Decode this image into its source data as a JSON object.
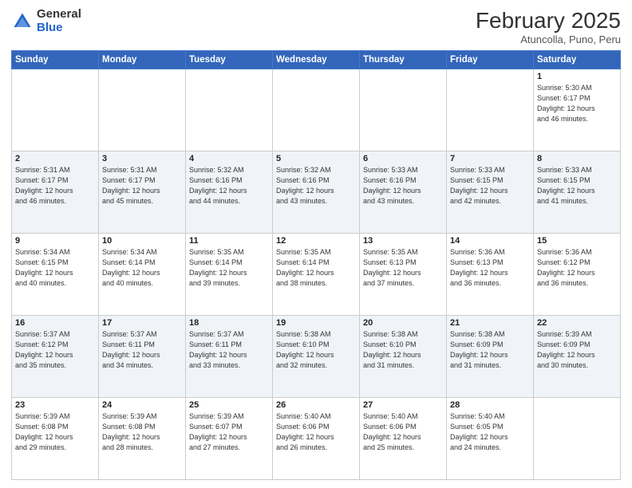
{
  "header": {
    "logo_general": "General",
    "logo_blue": "Blue",
    "month_year": "February 2025",
    "location": "Atuncolla, Puno, Peru"
  },
  "weekdays": [
    "Sunday",
    "Monday",
    "Tuesday",
    "Wednesday",
    "Thursday",
    "Friday",
    "Saturday"
  ],
  "weeks": [
    [
      {
        "day": "",
        "info": ""
      },
      {
        "day": "",
        "info": ""
      },
      {
        "day": "",
        "info": ""
      },
      {
        "day": "",
        "info": ""
      },
      {
        "day": "",
        "info": ""
      },
      {
        "day": "",
        "info": ""
      },
      {
        "day": "1",
        "info": "Sunrise: 5:30 AM\nSunset: 6:17 PM\nDaylight: 12 hours\nand 46 minutes."
      }
    ],
    [
      {
        "day": "2",
        "info": "Sunrise: 5:31 AM\nSunset: 6:17 PM\nDaylight: 12 hours\nand 46 minutes."
      },
      {
        "day": "3",
        "info": "Sunrise: 5:31 AM\nSunset: 6:17 PM\nDaylight: 12 hours\nand 45 minutes."
      },
      {
        "day": "4",
        "info": "Sunrise: 5:32 AM\nSunset: 6:16 PM\nDaylight: 12 hours\nand 44 minutes."
      },
      {
        "day": "5",
        "info": "Sunrise: 5:32 AM\nSunset: 6:16 PM\nDaylight: 12 hours\nand 43 minutes."
      },
      {
        "day": "6",
        "info": "Sunrise: 5:33 AM\nSunset: 6:16 PM\nDaylight: 12 hours\nand 43 minutes."
      },
      {
        "day": "7",
        "info": "Sunrise: 5:33 AM\nSunset: 6:15 PM\nDaylight: 12 hours\nand 42 minutes."
      },
      {
        "day": "8",
        "info": "Sunrise: 5:33 AM\nSunset: 6:15 PM\nDaylight: 12 hours\nand 41 minutes."
      }
    ],
    [
      {
        "day": "9",
        "info": "Sunrise: 5:34 AM\nSunset: 6:15 PM\nDaylight: 12 hours\nand 40 minutes."
      },
      {
        "day": "10",
        "info": "Sunrise: 5:34 AM\nSunset: 6:14 PM\nDaylight: 12 hours\nand 40 minutes."
      },
      {
        "day": "11",
        "info": "Sunrise: 5:35 AM\nSunset: 6:14 PM\nDaylight: 12 hours\nand 39 minutes."
      },
      {
        "day": "12",
        "info": "Sunrise: 5:35 AM\nSunset: 6:14 PM\nDaylight: 12 hours\nand 38 minutes."
      },
      {
        "day": "13",
        "info": "Sunrise: 5:35 AM\nSunset: 6:13 PM\nDaylight: 12 hours\nand 37 minutes."
      },
      {
        "day": "14",
        "info": "Sunrise: 5:36 AM\nSunset: 6:13 PM\nDaylight: 12 hours\nand 36 minutes."
      },
      {
        "day": "15",
        "info": "Sunrise: 5:36 AM\nSunset: 6:12 PM\nDaylight: 12 hours\nand 36 minutes."
      }
    ],
    [
      {
        "day": "16",
        "info": "Sunrise: 5:37 AM\nSunset: 6:12 PM\nDaylight: 12 hours\nand 35 minutes."
      },
      {
        "day": "17",
        "info": "Sunrise: 5:37 AM\nSunset: 6:11 PM\nDaylight: 12 hours\nand 34 minutes."
      },
      {
        "day": "18",
        "info": "Sunrise: 5:37 AM\nSunset: 6:11 PM\nDaylight: 12 hours\nand 33 minutes."
      },
      {
        "day": "19",
        "info": "Sunrise: 5:38 AM\nSunset: 6:10 PM\nDaylight: 12 hours\nand 32 minutes."
      },
      {
        "day": "20",
        "info": "Sunrise: 5:38 AM\nSunset: 6:10 PM\nDaylight: 12 hours\nand 31 minutes."
      },
      {
        "day": "21",
        "info": "Sunrise: 5:38 AM\nSunset: 6:09 PM\nDaylight: 12 hours\nand 31 minutes."
      },
      {
        "day": "22",
        "info": "Sunrise: 5:39 AM\nSunset: 6:09 PM\nDaylight: 12 hours\nand 30 minutes."
      }
    ],
    [
      {
        "day": "23",
        "info": "Sunrise: 5:39 AM\nSunset: 6:08 PM\nDaylight: 12 hours\nand 29 minutes."
      },
      {
        "day": "24",
        "info": "Sunrise: 5:39 AM\nSunset: 6:08 PM\nDaylight: 12 hours\nand 28 minutes."
      },
      {
        "day": "25",
        "info": "Sunrise: 5:39 AM\nSunset: 6:07 PM\nDaylight: 12 hours\nand 27 minutes."
      },
      {
        "day": "26",
        "info": "Sunrise: 5:40 AM\nSunset: 6:06 PM\nDaylight: 12 hours\nand 26 minutes."
      },
      {
        "day": "27",
        "info": "Sunrise: 5:40 AM\nSunset: 6:06 PM\nDaylight: 12 hours\nand 25 minutes."
      },
      {
        "day": "28",
        "info": "Sunrise: 5:40 AM\nSunset: 6:05 PM\nDaylight: 12 hours\nand 24 minutes."
      },
      {
        "day": "",
        "info": ""
      }
    ]
  ]
}
